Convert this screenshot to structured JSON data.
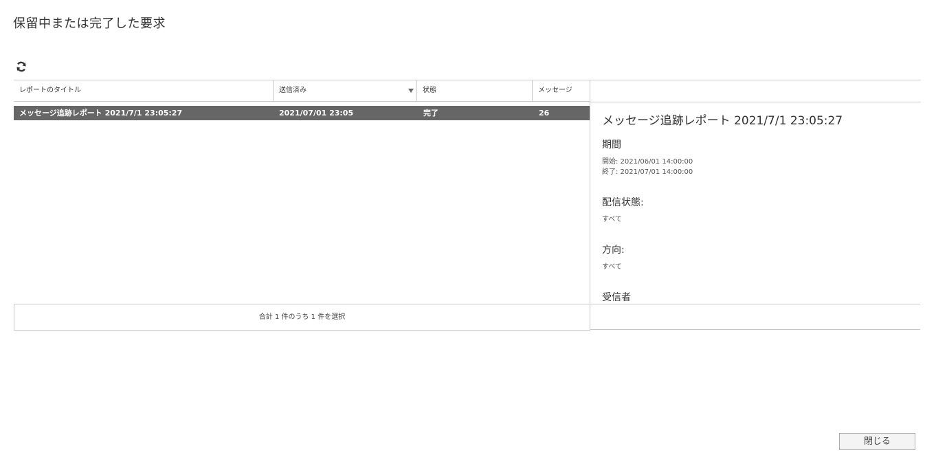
{
  "page": {
    "title": "保留中または完了した要求"
  },
  "toolbar": {
    "refresh_icon": "refresh-icon"
  },
  "table": {
    "columns": [
      {
        "label": "レポートのタイトル"
      },
      {
        "label": "送信済み",
        "sort": "descending"
      },
      {
        "label": "状態"
      },
      {
        "label": "メッセージ"
      }
    ],
    "rows": [
      {
        "title": "メッセージ追跡レポート 2021/7/1 23:05:27",
        "sent": "2021/07/01 23:05",
        "status": "完了",
        "messages": "26",
        "selected": true
      }
    ],
    "footer": "合計 1 件のうち 1 件を選択"
  },
  "detail": {
    "title": "メッセージ追跡レポート 2021/7/1 23:05:27",
    "period_heading": "期間",
    "period_start": "開始: 2021/06/01 14:00:00",
    "period_end": "終了: 2021/07/01 14:00:00",
    "delivery_status_heading": "配信状態:",
    "delivery_status_value": "すべて",
    "direction_heading": "方向:",
    "direction_value": "すべて",
    "recipients_heading": "受信者"
  },
  "buttons": {
    "close_label": "閉じる"
  },
  "colors": {
    "selected_row_bg": "#666666",
    "border": "#c8c8c8"
  }
}
